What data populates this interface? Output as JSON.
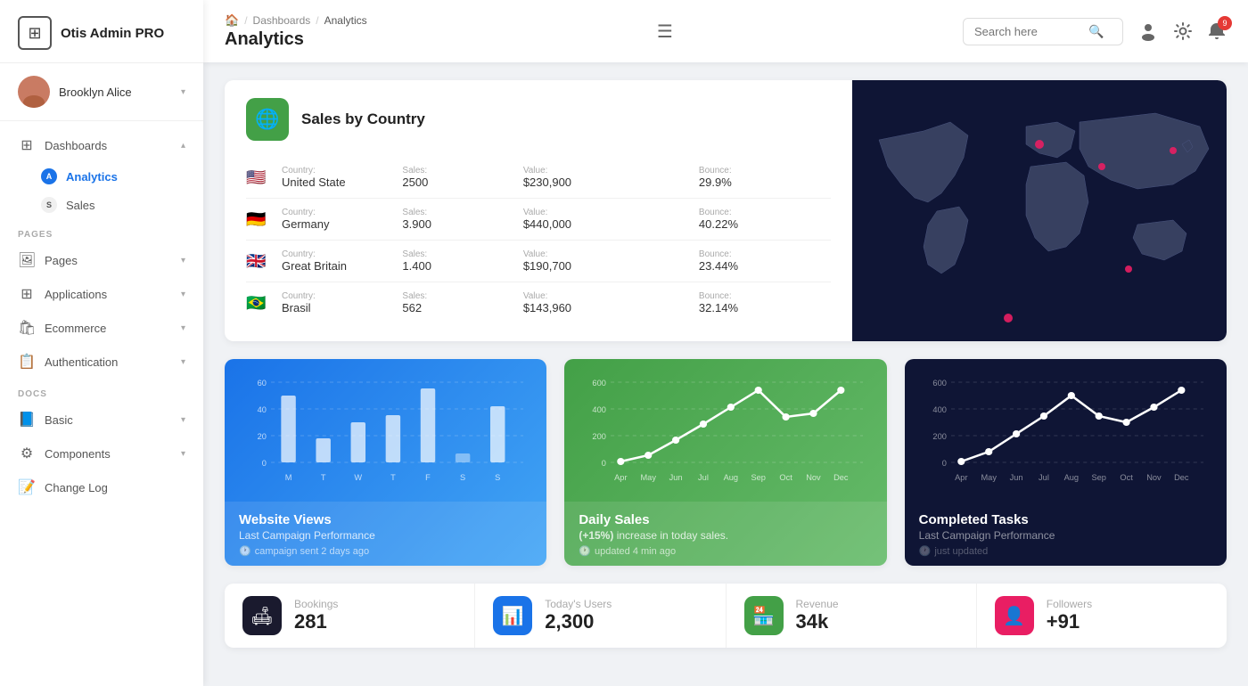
{
  "app": {
    "name": "Otis Admin PRO"
  },
  "user": {
    "name": "Brooklyn Alice"
  },
  "sidebar": {
    "sections": [
      {
        "items": [
          {
            "id": "dashboards",
            "label": "Dashboards",
            "icon": "⊞",
            "hasChevron": true,
            "expanded": true
          },
          {
            "id": "analytics",
            "label": "Analytics",
            "badge": "A",
            "isSubActive": true
          },
          {
            "id": "sales",
            "label": "Sales",
            "badge": "S"
          }
        ]
      }
    ],
    "pages_label": "PAGES",
    "pages": [
      {
        "id": "pages",
        "label": "Pages",
        "icon": "🖼",
        "hasChevron": true
      },
      {
        "id": "applications",
        "label": "Applications",
        "icon": "⊞",
        "hasChevron": true
      },
      {
        "id": "ecommerce",
        "label": "Ecommerce",
        "icon": "🛍",
        "hasChevron": true
      },
      {
        "id": "authentication",
        "label": "Authentication",
        "icon": "📋",
        "hasChevron": true
      }
    ],
    "docs_label": "DOCS",
    "docs": [
      {
        "id": "basic",
        "label": "Basic",
        "icon": "📘",
        "hasChevron": true
      },
      {
        "id": "components",
        "label": "Components",
        "icon": "⚙",
        "hasChevron": true
      },
      {
        "id": "changelog",
        "label": "Change Log",
        "icon": "📝"
      }
    ]
  },
  "header": {
    "breadcrumb": [
      "🏠",
      "Dashboards",
      "Analytics"
    ],
    "title": "Analytics",
    "search_placeholder": "Search here",
    "notif_count": "9"
  },
  "sales_by_country": {
    "title": "Sales by Country",
    "columns": [
      "Country:",
      "Sales:",
      "Value:",
      "Bounce:"
    ],
    "rows": [
      {
        "country": "United State",
        "flag": "🇺🇸",
        "sales": "2500",
        "value": "$230,900",
        "bounce": "29.9%"
      },
      {
        "country": "Germany",
        "flag": "🇩🇪",
        "sales": "3.900",
        "value": "$440,000",
        "bounce": "40.22%"
      },
      {
        "country": "Great Britain",
        "flag": "🇬🇧",
        "sales": "1.400",
        "value": "$190,700",
        "bounce": "23.44%"
      },
      {
        "country": "Brasil",
        "flag": "🇧🇷",
        "sales": "562",
        "value": "$143,960",
        "bounce": "32.14%"
      }
    ]
  },
  "website_views": {
    "title": "Website Views",
    "subtitle": "Last Campaign Performance",
    "footer": "campaign sent 2 days ago",
    "y_labels": [
      "60",
      "40",
      "20",
      "0"
    ],
    "x_labels": [
      "M",
      "T",
      "W",
      "T",
      "F",
      "S",
      "S"
    ],
    "bars": [
      45,
      20,
      30,
      35,
      55,
      10,
      40
    ]
  },
  "daily_sales": {
    "title": "Daily Sales",
    "badge": "(+15%)",
    "subtitle": "increase in today sales.",
    "footer": "updated 4 min ago",
    "y_labels": [
      "600",
      "400",
      "200",
      "0"
    ],
    "x_labels": [
      "Apr",
      "May",
      "Jun",
      "Jul",
      "Aug",
      "Sep",
      "Oct",
      "Nov",
      "Dec"
    ],
    "points": [
      5,
      20,
      120,
      220,
      350,
      480,
      280,
      300,
      490
    ]
  },
  "completed_tasks": {
    "title": "Completed Tasks",
    "subtitle": "Last Campaign Performance",
    "footer": "just updated",
    "y_labels": [
      "600",
      "400",
      "200",
      "0"
    ],
    "x_labels": [
      "Apr",
      "May",
      "Jun",
      "Jul",
      "Aug",
      "Sep",
      "Oct",
      "Nov",
      "Dec"
    ],
    "points": [
      10,
      80,
      200,
      320,
      450,
      300,
      250,
      350,
      490
    ]
  },
  "stats": [
    {
      "id": "bookings",
      "label": "Bookings",
      "value": "281",
      "icon": "🛋",
      "color": "dark"
    },
    {
      "id": "today_users",
      "label": "Today's Users",
      "value": "2,300",
      "icon": "📊",
      "color": "blue"
    },
    {
      "id": "revenue",
      "label": "Revenue",
      "value": "34k",
      "icon": "🏪",
      "color": "green"
    },
    {
      "id": "followers",
      "label": "Followers",
      "value": "+91",
      "icon": "👤",
      "color": "pink"
    }
  ]
}
